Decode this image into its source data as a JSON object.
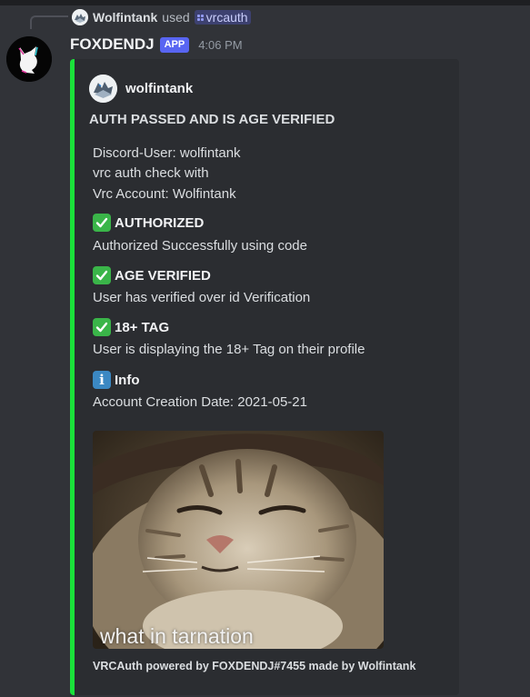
{
  "reply": {
    "user": "Wolfintank",
    "used_text": "used",
    "command": "vrcauth"
  },
  "message": {
    "username": "FOXDENDJ",
    "badge": "APP",
    "timestamp": "4:06 PM"
  },
  "embed": {
    "accent_color": "#1be13a",
    "author": "wolfintank",
    "title": "AUTH PASSED AND IS AGE VERIFIED",
    "description_lines": [
      "Discord-User: wolfintank",
      "vrc auth check with",
      "Vrc Account: Wolfintank"
    ],
    "fields": [
      {
        "icon": "check-mark-icon",
        "name": "AUTHORIZED",
        "value": "Authorized Successfully using code"
      },
      {
        "icon": "check-mark-icon",
        "name": "AGE VERIFIED",
        "value": "User has verified over id Verification"
      },
      {
        "icon": "check-mark-icon",
        "name": "18+ TAG",
        "value": "User is displaying the 18+ Tag on their profile"
      },
      {
        "icon": "info-icon",
        "name": "Info",
        "value": "Account Creation Date: 2021-05-21"
      }
    ],
    "image_caption": "what in tarnation",
    "footer": "VRCAuth powered by FOXDENDJ#7455 made by Wolfintank"
  }
}
